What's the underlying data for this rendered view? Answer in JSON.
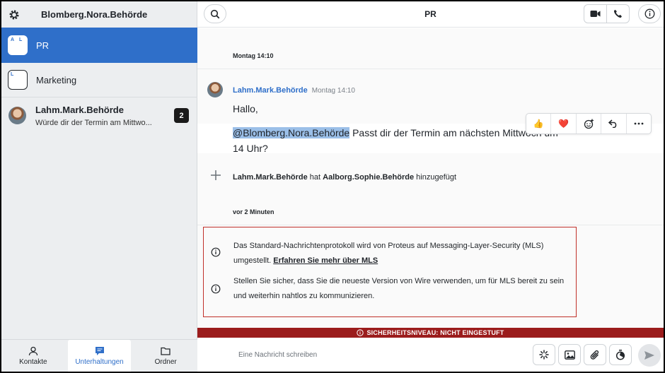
{
  "sidebar": {
    "account_name": "Blomberg.Nora.Behörde",
    "conversations": [
      {
        "name": "PR",
        "avatar_letters": [
          "A",
          "L"
        ],
        "active": true
      },
      {
        "name": "Marketing",
        "avatar_letters": [
          "L",
          ""
        ],
        "active": false
      },
      {
        "name": "Lahm.Mark.Behörde",
        "preview": "Würde dir der Termin am Mittwo...",
        "unread": "2",
        "active": false
      }
    ],
    "nav": [
      {
        "label": "Kontakte"
      },
      {
        "label": "Unterhaltungen",
        "active": true
      },
      {
        "label": "Ordner"
      }
    ]
  },
  "header": {
    "title": "PR"
  },
  "stream": {
    "date_1": "Montag 14:10",
    "message": {
      "author": "Lahm.Mark.Behörde",
      "time": "Montag 14:10",
      "line_1": "Hallo,",
      "mention": "@Blomberg.Nora.Behörde",
      "line_2_rest": " Passt dir der Termin am nächsten Mittwoch um",
      "line_3": "14 Uhr?"
    },
    "reactions": [
      "👍",
      "❤️"
    ],
    "system": {
      "actor": "Lahm.Mark.Behörde",
      "verb": " hat ",
      "target": "Aalborg.Sophie.Behörde",
      "suffix": " hinzugefügt"
    },
    "date_2": "vor 2 Minuten",
    "mls": {
      "line_1": "Das Standard-Nachrichtenprotokoll wird von Proteus auf Messaging-Layer-Security (MLS)",
      "line_2": "umgestellt. ",
      "link": "Erfahren Sie mehr über MLS",
      "line_3": "Stellen Sie sicher, dass Sie die neueste Version von Wire verwenden, um für MLS bereit zu sein",
      "line_4": "und weiterhin nahtlos zu kommunizieren."
    }
  },
  "security_bar": "SICHERHEITSNIVEAU: NICHT EINGESTUFT",
  "composer": {
    "placeholder": "Eine Nachricht schreiben"
  },
  "colors": {
    "accent": "#2f6fc9",
    "security_bar": "#9b1c1c",
    "mls_border": "#c0302a"
  }
}
